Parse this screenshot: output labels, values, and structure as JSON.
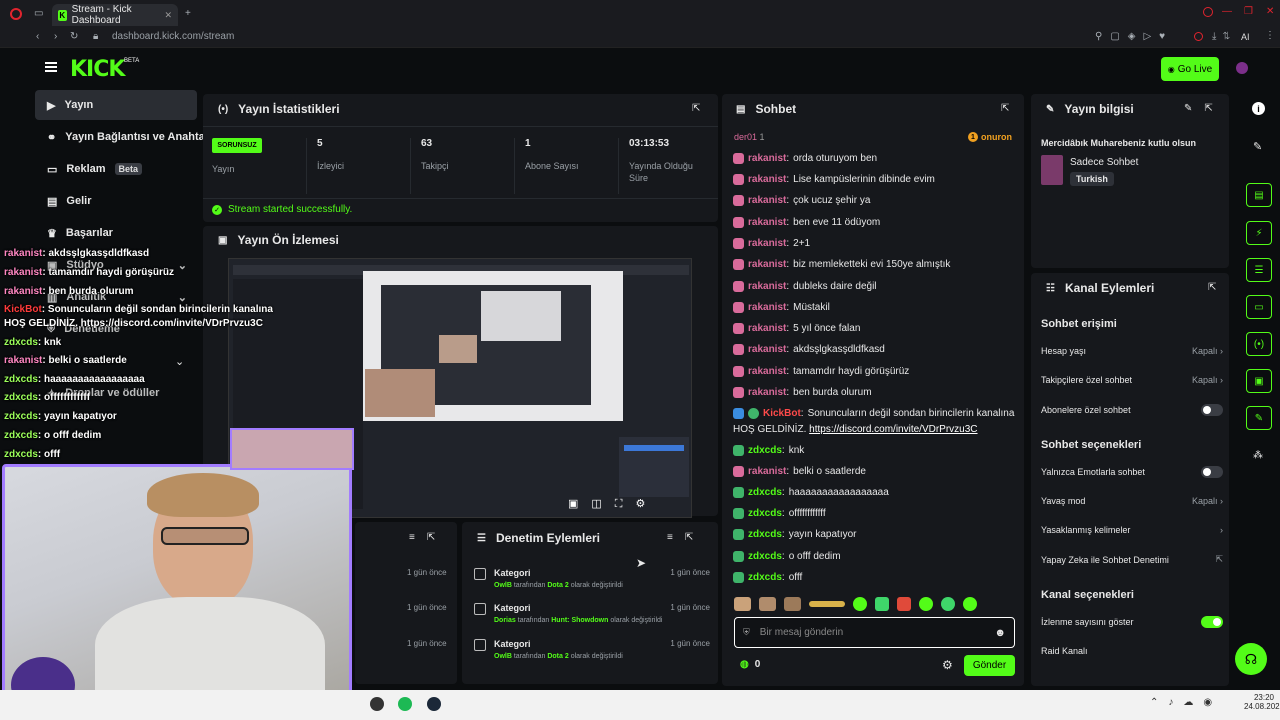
{
  "browser": {
    "tab_title": "Stream - Kick Dashboard",
    "url": "dashboard.kick.com/stream",
    "ai_label": "AI"
  },
  "header": {
    "logo": "KICK",
    "beta": "BETA",
    "go_live": "Go Live"
  },
  "sidebar": {
    "items": [
      {
        "label": "Yayın",
        "icon": "play-icon"
      },
      {
        "label": "Yayın Bağlantısı ve Anahtarı",
        "icon": "link-icon"
      },
      {
        "label": "Reklam",
        "icon": "ad-icon",
        "badge": "Beta"
      },
      {
        "label": "Gelir",
        "icon": "money-icon"
      },
      {
        "label": "Başarılar",
        "icon": "trophy-icon"
      },
      {
        "label": "Stüdyo",
        "icon": "studio-icon"
      },
      {
        "label": "Analitik",
        "icon": "chart-icon"
      },
      {
        "label": "Denetleme",
        "icon": "shield-icon"
      },
      {
        "label": "Droplar ve ödüller",
        "icon": "gift-icon"
      }
    ]
  },
  "stats": {
    "title": "Yayın İstatistikleri",
    "status_badge": "SORUNSUZ",
    "status_label": "Yayın",
    "items": [
      {
        "value": "5",
        "label": "İzleyici"
      },
      {
        "value": "63",
        "label": "Takipçi"
      },
      {
        "value": "1",
        "label": "Abone Sayısı"
      },
      {
        "value": "03:13:53",
        "label": "Yayında Olduğu Süre"
      }
    ],
    "success": "Stream started successfully."
  },
  "preview": {
    "title": "Yayın Ön İzlemesi"
  },
  "moderation": {
    "title": "Denetim Eylemleri",
    "items": [
      {
        "title": "Kategori",
        "user": "OwlB",
        "mid": "tarafından",
        "game": "Dota 2",
        "end": "olarak değiştirildi",
        "time": "1 gün önce"
      },
      {
        "title": "Kategori",
        "user": "Dorias",
        "mid": "tarafından",
        "game": "Hunt: Showdown",
        "end": "olarak değiştirildi",
        "time": "1 gün önce"
      },
      {
        "title": "Kategori",
        "user": "OwlB",
        "mid": "tarafından",
        "game": "Dota 2",
        "end": "olarak değiştirildi",
        "time": "1 gün önce"
      }
    ],
    "left_times": [
      "1 gün önce",
      "1 gün önce",
      "1 gün önce"
    ]
  },
  "chat": {
    "title": "Sohbet",
    "pinned_user": "der01",
    "pinned_count": "1",
    "pinned_right": "onuron",
    "messages": [
      {
        "user": "rakanist",
        "text": "orda oturuyom ben",
        "kind": "p"
      },
      {
        "user": "rakanist",
        "text": "Lise kampüslerinin dibinde evim",
        "kind": "p"
      },
      {
        "user": "rakanist",
        "text": "çok ucuz şehir ya",
        "kind": "p"
      },
      {
        "user": "rakanist",
        "text": "ben eve 11 ödüyom",
        "kind": "p"
      },
      {
        "user": "rakanist",
        "text": "2+1",
        "kind": "p"
      },
      {
        "user": "rakanist",
        "text": "biz memleketteki evi 150ye almıştık",
        "kind": "p"
      },
      {
        "user": "rakanist",
        "text": "dubleks daire değil",
        "kind": "p"
      },
      {
        "user": "rakanist",
        "text": "Müstakil",
        "kind": "p"
      },
      {
        "user": "rakanist",
        "text": "5 yıl önce falan",
        "kind": "p"
      },
      {
        "user": "rakanist",
        "text": "akdsşlgkasşdldfkasd",
        "kind": "p"
      },
      {
        "user": "rakanist",
        "text": "tamamdır haydi görüşürüz",
        "kind": "p"
      },
      {
        "user": "rakanist",
        "text": "ben burda olurum",
        "kind": "p"
      },
      {
        "user": "KickBot",
        "text": "Sonuncuların değil sondan birincilerin kanalına",
        "kind": "b"
      },
      {
        "user": "zdxcds",
        "text": "knk",
        "kind": "g"
      },
      {
        "user": "rakanist",
        "text": "belki o saatlerde",
        "kind": "p"
      },
      {
        "user": "zdxcds",
        "text": "haaaaaaaaaaaaaaaaa",
        "kind": "g"
      },
      {
        "user": "zdxcds",
        "text": "offffffffffff",
        "kind": "g"
      },
      {
        "user": "zdxcds",
        "text": "yayın kapatıyor",
        "kind": "g"
      },
      {
        "user": "zdxcds",
        "text": "o offf dedim",
        "kind": "g"
      },
      {
        "user": "zdxcds",
        "text": "offf",
        "kind": "g"
      }
    ],
    "bot_line2_prefix": "HOŞ GELDİNİZ.",
    "bot_link": "https://discord.com/invite/VDrPrvzu3C",
    "input_placeholder": "Bir mesaj gönderin",
    "points": "0",
    "send": "Gönder"
  },
  "stream_info": {
    "title": "Yayın bilgisi",
    "stream_title": "Mercidâbık Muharebeniz kutlu olsun",
    "category": "Sadece Sohbet",
    "language": "Turkish"
  },
  "channel_actions": {
    "title": "Kanal Eylemleri",
    "chat_access": "Sohbet erişimi",
    "account_age": {
      "label": "Hesap yaşı",
      "value": "Kapalı"
    },
    "followers_only": {
      "label": "Takipçilere özel sohbet",
      "value": "Kapalı"
    },
    "subs_only": "Abonelere özel sohbet",
    "chat_options": "Sohbet seçenekleri",
    "emote_only": "Yalnızca Emotlarla sohbet",
    "slow_mode": {
      "label": "Yavaş mod",
      "value": "Kapalı"
    },
    "banned_words": "Yasaklanmış kelimeler",
    "ai_moderation": "Yapay Zeka ile Sohbet Denetimi",
    "channel_options": "Kanal seçenekleri",
    "show_viewers": "İzlenme sayısını göster",
    "raid": "Raid Kanalı"
  },
  "overlay_chat": [
    {
      "user": "rakanist",
      "text": "akdsşlgkasşdldfkasd",
      "kind": "p"
    },
    {
      "user": "rakanist",
      "text": "tamamdır haydi görüşürüz",
      "kind": "p"
    },
    {
      "user": "rakanist",
      "text": "ben burda olurum",
      "kind": "p"
    },
    {
      "user": "KickBot",
      "text": "Sonuncuların değil sondan birincilerin kanalına",
      "kind": "b"
    },
    {
      "user": "",
      "text": "HOŞ GELDİNİZ. https://discord.com/invite/VDrPrvzu3C",
      "kind": "x"
    },
    {
      "user": "zdxcds",
      "text": "knk",
      "kind": "g"
    },
    {
      "user": "rakanist",
      "text": "belki o saatlerde",
      "kind": "p"
    },
    {
      "user": "zdxcds",
      "text": "haaaaaaaaaaaaaaaaa",
      "kind": "g"
    },
    {
      "user": "zdxcds",
      "text": "offffffffffff",
      "kind": "g"
    },
    {
      "user": "zdxcds",
      "text": "yayın kapatıyor",
      "kind": "g"
    },
    {
      "user": "zdxcds",
      "text": "o offf dedim",
      "kind": "g"
    },
    {
      "user": "zdxcds",
      "text": "offf",
      "kind": "g"
    }
  ],
  "taskbar": {
    "time": "23:20",
    "date": "24.08.2026"
  },
  "colors": {
    "accent": "#53fc18",
    "pink": "#d96b9b"
  }
}
